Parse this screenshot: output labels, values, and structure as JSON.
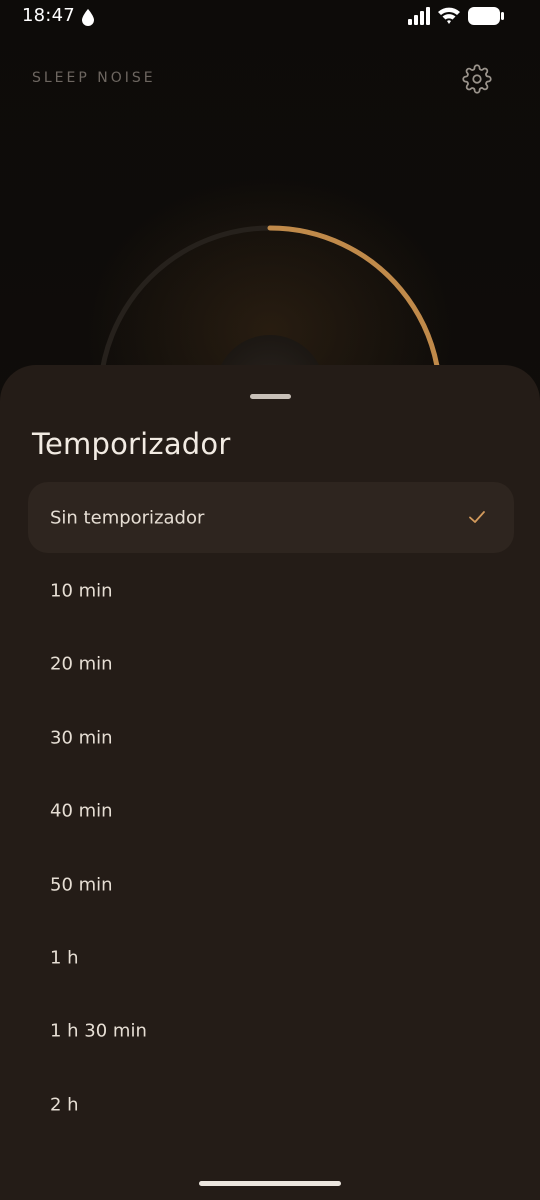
{
  "status_bar": {
    "time": "18:47",
    "icons": [
      "drop-icon",
      "signal-icon",
      "wifi-icon",
      "battery-icon"
    ]
  },
  "header": {
    "app_title": "SLEEP NOISE",
    "settings_icon": "gear-icon"
  },
  "dial": {
    "progress_fraction": 0.3,
    "accent_color": "#c08a4a",
    "track_color": "#26211c"
  },
  "sheet": {
    "title": "Temporizador",
    "options": [
      {
        "label": "Sin temporizador",
        "selected": true
      },
      {
        "label": "10 min",
        "selected": false
      },
      {
        "label": "20 min",
        "selected": false
      },
      {
        "label": "30 min",
        "selected": false
      },
      {
        "label": "40 min",
        "selected": false
      },
      {
        "label": "50 min",
        "selected": false
      },
      {
        "label": "1 h",
        "selected": false
      },
      {
        "label": "1 h 30 min",
        "selected": false
      },
      {
        "label": "2 h",
        "selected": false
      }
    ],
    "check_icon": "check-icon",
    "check_color": "#d39a5c",
    "background_color": "#241c17"
  }
}
